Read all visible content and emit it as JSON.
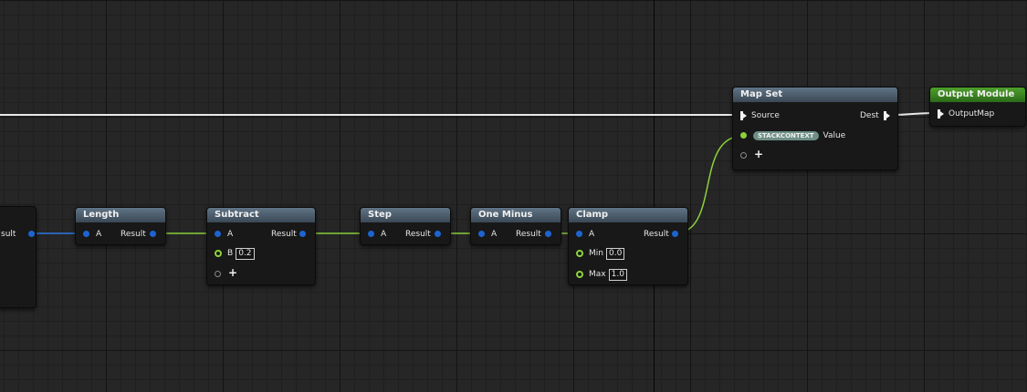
{
  "nodes": {
    "partial": {
      "output_label": "sult"
    },
    "length": {
      "title": "Length",
      "input_a": "A",
      "output": "Result"
    },
    "subtract": {
      "title": "Subtract",
      "input_a": "A",
      "input_b": "B",
      "input_b_value": "0.2",
      "output": "Result"
    },
    "step": {
      "title": "Step",
      "input_a": "A",
      "output": "Result"
    },
    "one_minus": {
      "title": "One Minus",
      "input_a": "A",
      "output": "Result"
    },
    "clamp": {
      "title": "Clamp",
      "input_a": "A",
      "input_min": "Min",
      "input_min_value": "0.0",
      "input_max": "Max",
      "input_max_value": "1.0",
      "output": "Result"
    },
    "map_set": {
      "title": "Map Set",
      "source": "Source",
      "dest": "Dest",
      "badge": "STACKCONTEXT",
      "value": "Value"
    },
    "output_module": {
      "title": "Output Module",
      "output_map": "OutputMap"
    }
  },
  "colors": {
    "float_pin": "#1d64d1",
    "green_pin": "#8cd23c",
    "exec_pin": "#f2f2f2",
    "header_default": "#4b5c6b",
    "header_output": "#3e8a24"
  }
}
